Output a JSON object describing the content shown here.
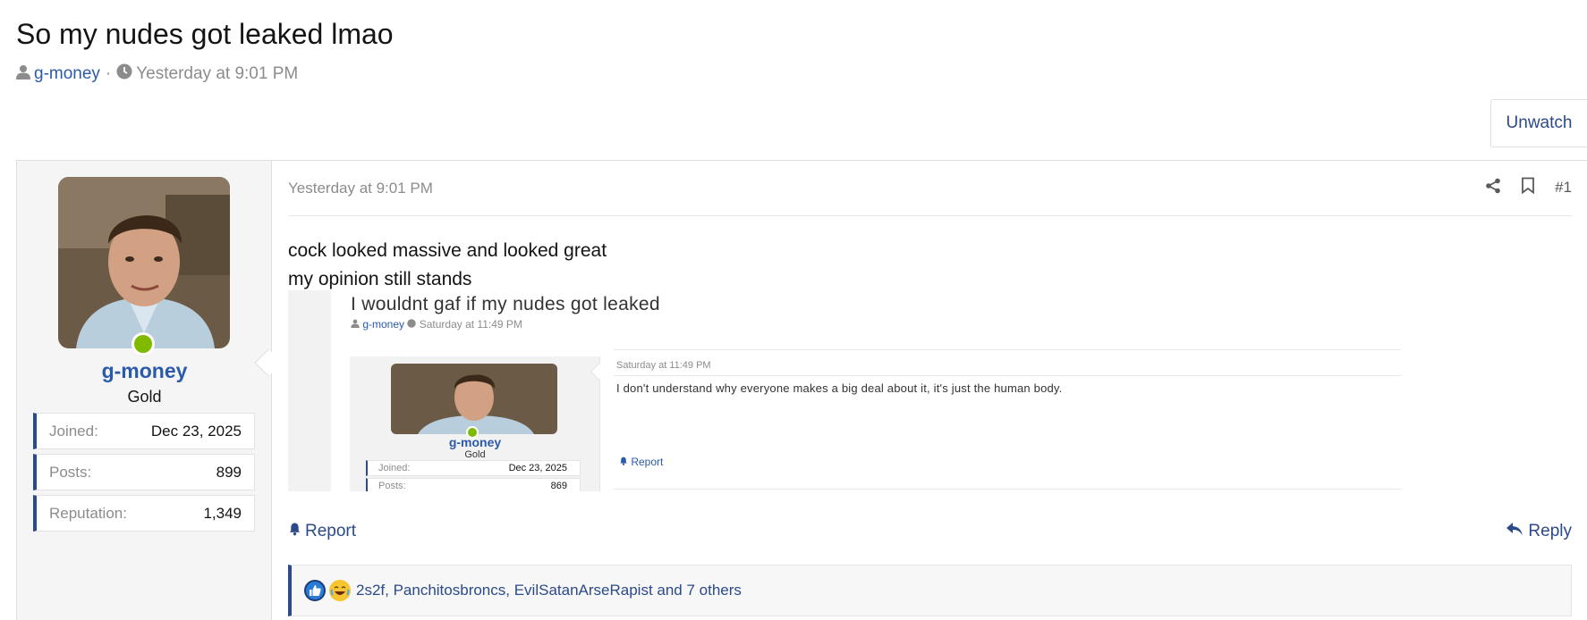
{
  "thread": {
    "title": "So my nudes got leaked lmao",
    "author": "g-money",
    "separator": "·",
    "time": "Yesterday at 9:01 PM",
    "unwatch_label": "Unwatch"
  },
  "user": {
    "name": "g-money",
    "title": "Gold",
    "stats": [
      {
        "label": "Joined:",
        "value": "Dec 23, 2025"
      },
      {
        "label": "Posts:",
        "value": "899"
      },
      {
        "label": "Reputation:",
        "value": "1,349"
      }
    ]
  },
  "post": {
    "date": "Yesterday at 9:01 PM",
    "number": "#1",
    "lines": [
      "cock looked massive and looked great",
      "my opinion still stands"
    ],
    "report_label": "Report",
    "reply_label": "Reply"
  },
  "embed": {
    "title": "I wouldnt gaf if my nudes got leaked",
    "author": "g-money",
    "time": "Saturday at 11:49 PM",
    "user_name": "g-money",
    "user_title": "Gold",
    "stats": [
      {
        "label": "Joined:",
        "value": "Dec 23, 2025"
      },
      {
        "label": "Posts:",
        "value": "869"
      }
    ],
    "date": "Saturday at 11:49 PM",
    "text": "I don't understand why everyone makes a big deal about it, it's just the human body.",
    "report_label": "Report"
  },
  "reactions": {
    "icons": [
      "like-icon",
      "laugh-icon"
    ],
    "text": "2s2f, Panchitosbroncs, EvilSatanArseRapist and 7 others"
  },
  "colors": {
    "link": "#2b5aab",
    "accent": "#2b4a8a",
    "online": "#7fb900",
    "muted": "#8c8c8c"
  }
}
